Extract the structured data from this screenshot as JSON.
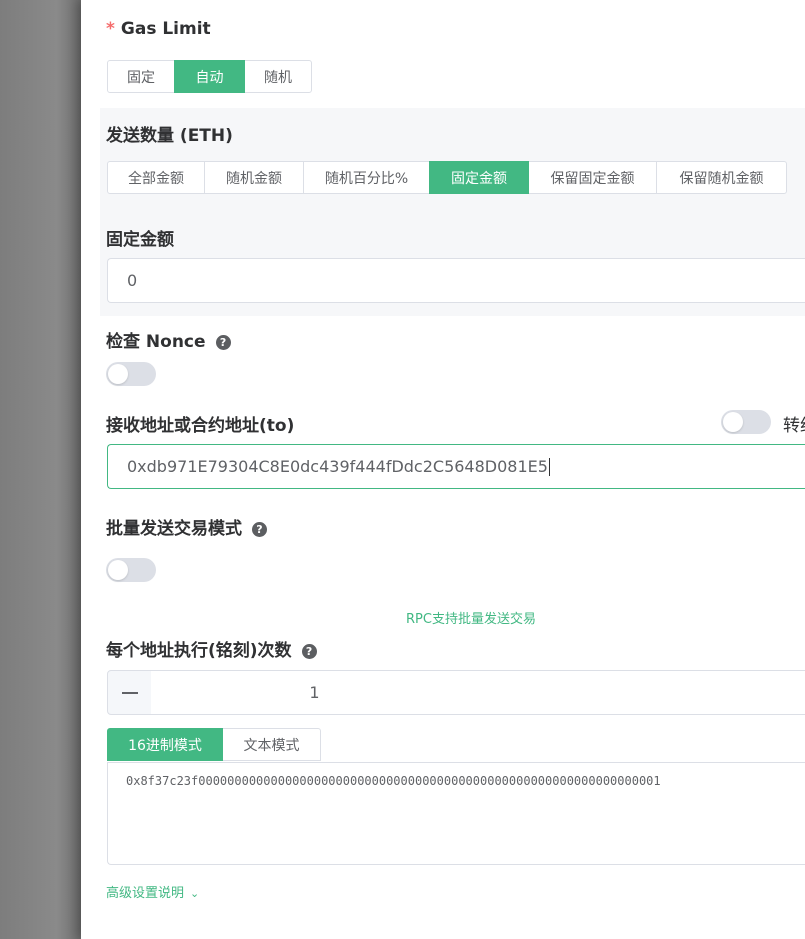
{
  "gas_limit": {
    "label": "Gas Limit",
    "required_mark": "*",
    "options": [
      "固定",
      "自动",
      "随机"
    ],
    "selected": "自动"
  },
  "send_amount": {
    "label": "发送数量 (ETH)",
    "options": [
      "全部金额",
      "随机金额",
      "随机百分比%",
      "固定金额",
      "保留固定金额",
      "保留随机金额"
    ],
    "selected": "固定金额"
  },
  "fixed_amount": {
    "label": "固定金额",
    "value": "0"
  },
  "check_nonce": {
    "label": "检查 Nonce",
    "enabled": false
  },
  "recipient": {
    "label": "接收地址或合约地址(to)",
    "value": "0xdb971E79304C8E0dc439f444fDdc2C5648D081E5",
    "side_toggle_label": "转约",
    "side_toggle_enabled": false
  },
  "batch_mode": {
    "label": "批量发送交易模式",
    "enabled": false,
    "note": "RPC支持批量发送交易"
  },
  "exec_count": {
    "label": "每个地址执行(铭刻)次数",
    "value": "1"
  },
  "data_mode": {
    "tabs": [
      "16进制模式",
      "文本模式"
    ],
    "selected": "16进制模式",
    "value": "0x8f37c23f0000000000000000000000000000000000000000000000000000000000000001"
  },
  "advanced": {
    "link_label": "高级设置说明"
  },
  "icons": {
    "help": "question-circle-icon",
    "minus": "minus-icon",
    "chevron": "chevron-down-icon"
  },
  "colors": {
    "accent": "#42b883",
    "required": "#f56c6c",
    "switch_off": "#dcdfe6"
  }
}
